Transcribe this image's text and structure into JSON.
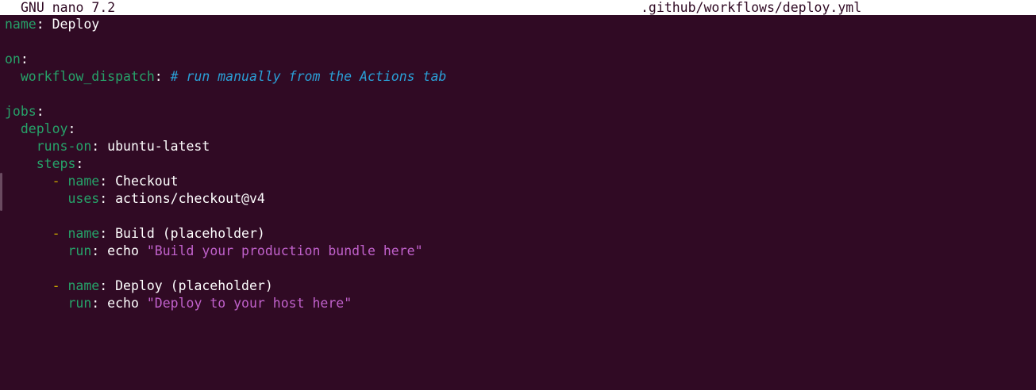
{
  "titlebar": {
    "app": "GNU nano 7.2",
    "filename": ".github/workflows/deploy.yml"
  },
  "lines": [
    [
      {
        "t": "name",
        "c": "key"
      },
      {
        "t": ": Deploy",
        "c": "plain"
      }
    ],
    [],
    [
      {
        "t": "on",
        "c": "key"
      },
      {
        "t": ":",
        "c": "plain"
      }
    ],
    [
      {
        "t": "  ",
        "c": "plain"
      },
      {
        "t": "workflow_dispatch",
        "c": "key"
      },
      {
        "t": ": ",
        "c": "plain"
      },
      {
        "t": "# run manually from the Actions tab",
        "c": "cmt"
      }
    ],
    [],
    [
      {
        "t": "jobs",
        "c": "key"
      },
      {
        "t": ":",
        "c": "plain"
      }
    ],
    [
      {
        "t": "  ",
        "c": "plain"
      },
      {
        "t": "deploy",
        "c": "key"
      },
      {
        "t": ":",
        "c": "plain"
      }
    ],
    [
      {
        "t": "    ",
        "c": "plain"
      },
      {
        "t": "runs-on",
        "c": "key"
      },
      {
        "t": ": ubuntu-latest",
        "c": "plain"
      }
    ],
    [
      {
        "t": "    ",
        "c": "plain"
      },
      {
        "t": "steps",
        "c": "key"
      },
      {
        "t": ":",
        "c": "plain"
      }
    ],
    [
      {
        "t": "      ",
        "c": "plain"
      },
      {
        "t": "-",
        "c": "dash"
      },
      {
        "t": " ",
        "c": "plain"
      },
      {
        "t": "name",
        "c": "key"
      },
      {
        "t": ": Checkout",
        "c": "plain"
      }
    ],
    [
      {
        "t": "        ",
        "c": "plain"
      },
      {
        "t": "uses",
        "c": "key"
      },
      {
        "t": ": actions/checkout@v4",
        "c": "plain"
      }
    ],
    [],
    [
      {
        "t": "      ",
        "c": "plain"
      },
      {
        "t": "-",
        "c": "dash"
      },
      {
        "t": " ",
        "c": "plain"
      },
      {
        "t": "name",
        "c": "key"
      },
      {
        "t": ": Build (placeholder)",
        "c": "plain"
      }
    ],
    [
      {
        "t": "        ",
        "c": "plain"
      },
      {
        "t": "run",
        "c": "key"
      },
      {
        "t": ": echo ",
        "c": "plain"
      },
      {
        "t": "\"Build your production bundle here\"",
        "c": "str"
      }
    ],
    [],
    [
      {
        "t": "      ",
        "c": "plain"
      },
      {
        "t": "-",
        "c": "dash"
      },
      {
        "t": " ",
        "c": "plain"
      },
      {
        "t": "name",
        "c": "key"
      },
      {
        "t": ": Deploy (placeholder)",
        "c": "plain"
      }
    ],
    [
      {
        "t": "        ",
        "c": "plain"
      },
      {
        "t": "run",
        "c": "key"
      },
      {
        "t": ": echo ",
        "c": "plain"
      },
      {
        "t": "\"Deploy to your host here\"",
        "c": "str"
      }
    ]
  ],
  "colors": {
    "background": "#300a24",
    "titlebar_bg": "#ffffff",
    "key": "#26a269",
    "comment": "#2a9fd6",
    "string": "#c061cb",
    "dash": "#c4a000"
  }
}
